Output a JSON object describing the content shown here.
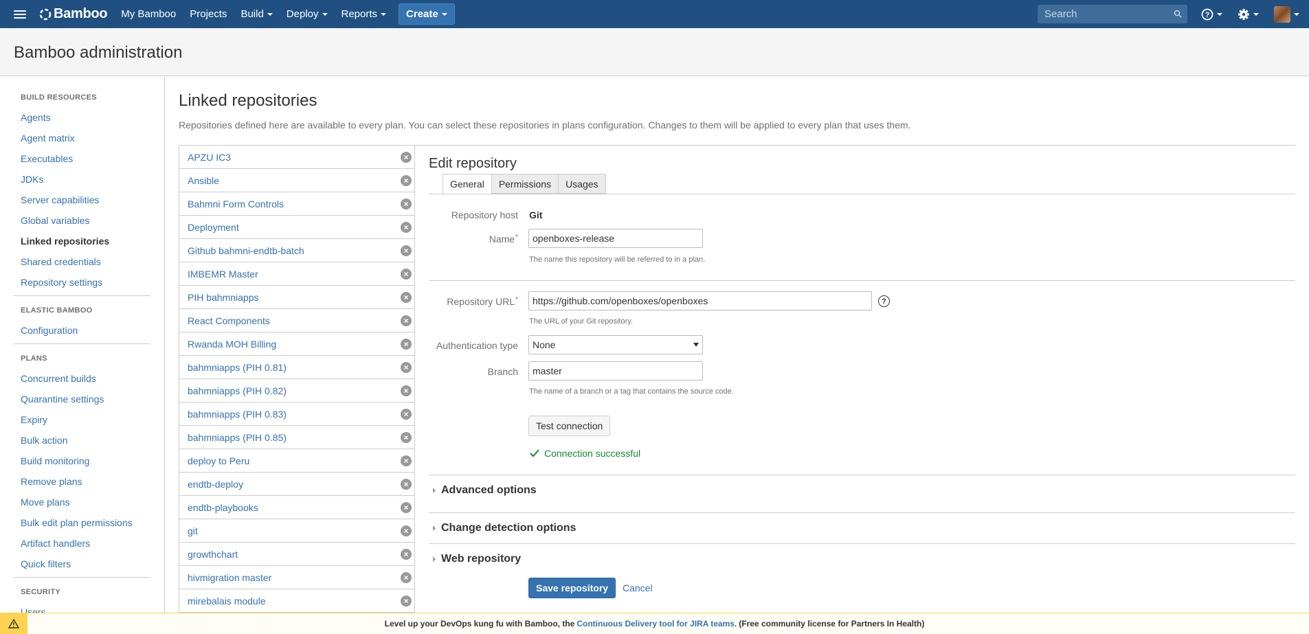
{
  "topnav": {
    "app_name": "Bamboo",
    "items": [
      "My Bamboo",
      "Projects",
      "Build",
      "Deploy",
      "Reports"
    ],
    "create_label": "Create",
    "search_placeholder": "Search"
  },
  "page_header": {
    "title": "Bamboo administration"
  },
  "sidebar": {
    "sections": [
      {
        "title": "BUILD RESOURCES",
        "items": [
          "Agents",
          "Agent matrix",
          "Executables",
          "JDKs",
          "Server capabilities",
          "Global variables",
          "Linked repositories",
          "Shared credentials",
          "Repository settings"
        ]
      },
      {
        "title": "ELASTIC BAMBOO",
        "items": [
          "Configuration"
        ]
      },
      {
        "title": "PLANS",
        "items": [
          "Concurrent builds",
          "Quarantine settings",
          "Expiry",
          "Bulk action",
          "Build monitoring",
          "Remove plans",
          "Move plans",
          "Bulk edit plan permissions",
          "Artifact handlers",
          "Quick filters"
        ]
      },
      {
        "title": "SECURITY",
        "items": [
          "Users"
        ]
      }
    ],
    "active_item": "Linked repositories"
  },
  "main": {
    "title": "Linked repositories",
    "description": "Repositories defined here are available to every plan. You can select these repositories in plans configuration. Changes to them will be applied to every plan that uses them.",
    "repositories": [
      "APZU IC3",
      "Ansible",
      "Bahmni Form Controls",
      "Deployment",
      "Github bahmni-endtb-batch",
      "IMBEMR Master",
      "PIH bahmniapps",
      "React Components",
      "Rwanda MOH Billing",
      "bahmniapps (PIH 0.81)",
      "bahmniapps (PIH 0.82)",
      "bahmniapps (PIH 0.83)",
      "bahmniapps (PIH 0.85)",
      "deploy to Peru",
      "endtb-deploy",
      "endtb-playbooks",
      "git",
      "growthchart",
      "hivmigration master",
      "mirebalais module"
    ]
  },
  "edit": {
    "title": "Edit repository",
    "tabs": [
      "General",
      "Permissions",
      "Usages"
    ],
    "active_tab": "General",
    "repo_host_label": "Repository host",
    "repo_host_value": "Git",
    "name_label": "Name",
    "name_value": "openboxes-release",
    "name_hint": "The name this repository will be referred to in a plan.",
    "url_label": "Repository URL",
    "url_value": "https://github.com/openboxes/openboxes",
    "url_hint": "The URL of your Git repository.",
    "auth_label": "Authentication type",
    "auth_value": "None",
    "branch_label": "Branch",
    "branch_value": "master",
    "branch_hint": "The name of a branch or a tag that contains the source code.",
    "test_button": "Test connection",
    "connection_status": "Connection successful",
    "advanced": "Advanced options",
    "change_detection": "Change detection options",
    "web_repo": "Web repository",
    "save_button": "Save repository",
    "cancel_link": "Cancel"
  },
  "banner": {
    "prefix": "Level up your DevOps kung fu with Bamboo, the",
    "link": "Continuous Delivery tool for JIRA teams.",
    "suffix": "(Free community license for Partners In Health)"
  },
  "colors": {
    "nav_bg": "#205081",
    "link": "#3572b0",
    "success": "#14892c",
    "banner_warn": "#ffd351"
  }
}
